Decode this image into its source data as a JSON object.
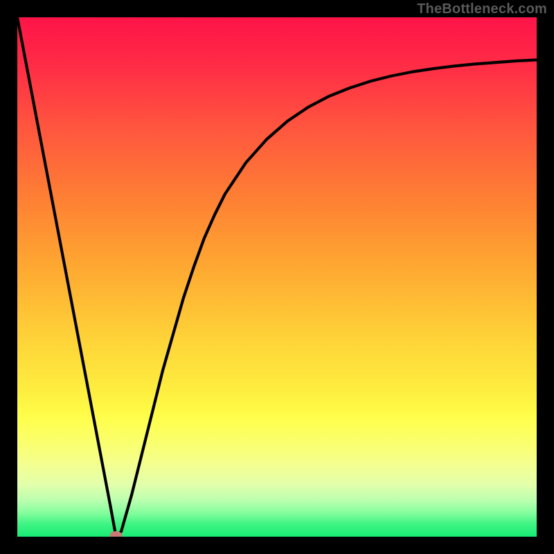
{
  "watermark": "TheBottleneck.com",
  "colors": {
    "black": "#000000",
    "curve": "#000000",
    "marker": "#c97a74",
    "grad_top": "#fe1448",
    "grad_mid_upper": "#fd8532",
    "grad_mid": "#fed638",
    "grad_mid_lower": "#fffb47",
    "grad_band": "#f4ff8f",
    "grad_bottom": "#17ec74"
  },
  "chart_data": {
    "type": "line",
    "title": "",
    "xlabel": "",
    "ylabel": "",
    "xlim": [
      0,
      100
    ],
    "ylim": [
      0,
      100
    ],
    "curve": {
      "x": [
        0,
        2,
        4,
        6,
        8,
        10,
        12,
        14,
        16,
        18,
        19,
        20,
        22,
        24,
        26,
        28,
        30,
        32,
        34,
        36,
        38,
        40,
        44,
        48,
        52,
        56,
        60,
        64,
        68,
        72,
        76,
        80,
        84,
        88,
        92,
        96,
        100
      ],
      "y": [
        100,
        89.5,
        79,
        68.5,
        58,
        47.5,
        37,
        26.5,
        16,
        5.5,
        0,
        1,
        8,
        16,
        24,
        32,
        39,
        46,
        52,
        57.5,
        62,
        66,
        72,
        76.5,
        80,
        82.7,
        84.8,
        86.4,
        87.7,
        88.7,
        89.5,
        90.1,
        90.6,
        91,
        91.3,
        91.6,
        91.8
      ]
    },
    "marker": {
      "x": 19,
      "y": 0
    },
    "gradient_bands": [
      {
        "stop": 0,
        "note": "top red"
      },
      {
        "stop": 76,
        "note": "yellow band begins"
      },
      {
        "stop": 97,
        "note": "green floor"
      }
    ]
  }
}
